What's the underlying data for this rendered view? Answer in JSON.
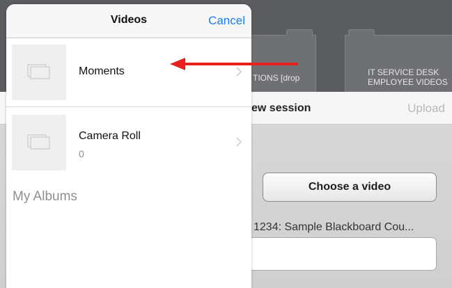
{
  "background_app": {
    "folders": [
      {
        "label": "TIONS [drop"
      },
      {
        "label": "IT SERVICE DESK EMPLOYEE VIDEOS"
      }
    ],
    "session_header": {
      "title": "ew session",
      "upload_label": "Upload"
    },
    "choose_video_label": "Choose a video",
    "course_label": "1234: Sample Blackboard Cou..."
  },
  "picker": {
    "title": "Videos",
    "cancel_label": "Cancel",
    "albums": [
      {
        "name": "Moments",
        "count": "",
        "icon": "album-placeholder-icon"
      },
      {
        "name": "Camera Roll",
        "count": "0",
        "icon": "album-placeholder-icon"
      }
    ],
    "section_header": "My Albums"
  },
  "colors": {
    "accent": "#1a7ef0",
    "annotation_arrow": "#e8211f"
  }
}
